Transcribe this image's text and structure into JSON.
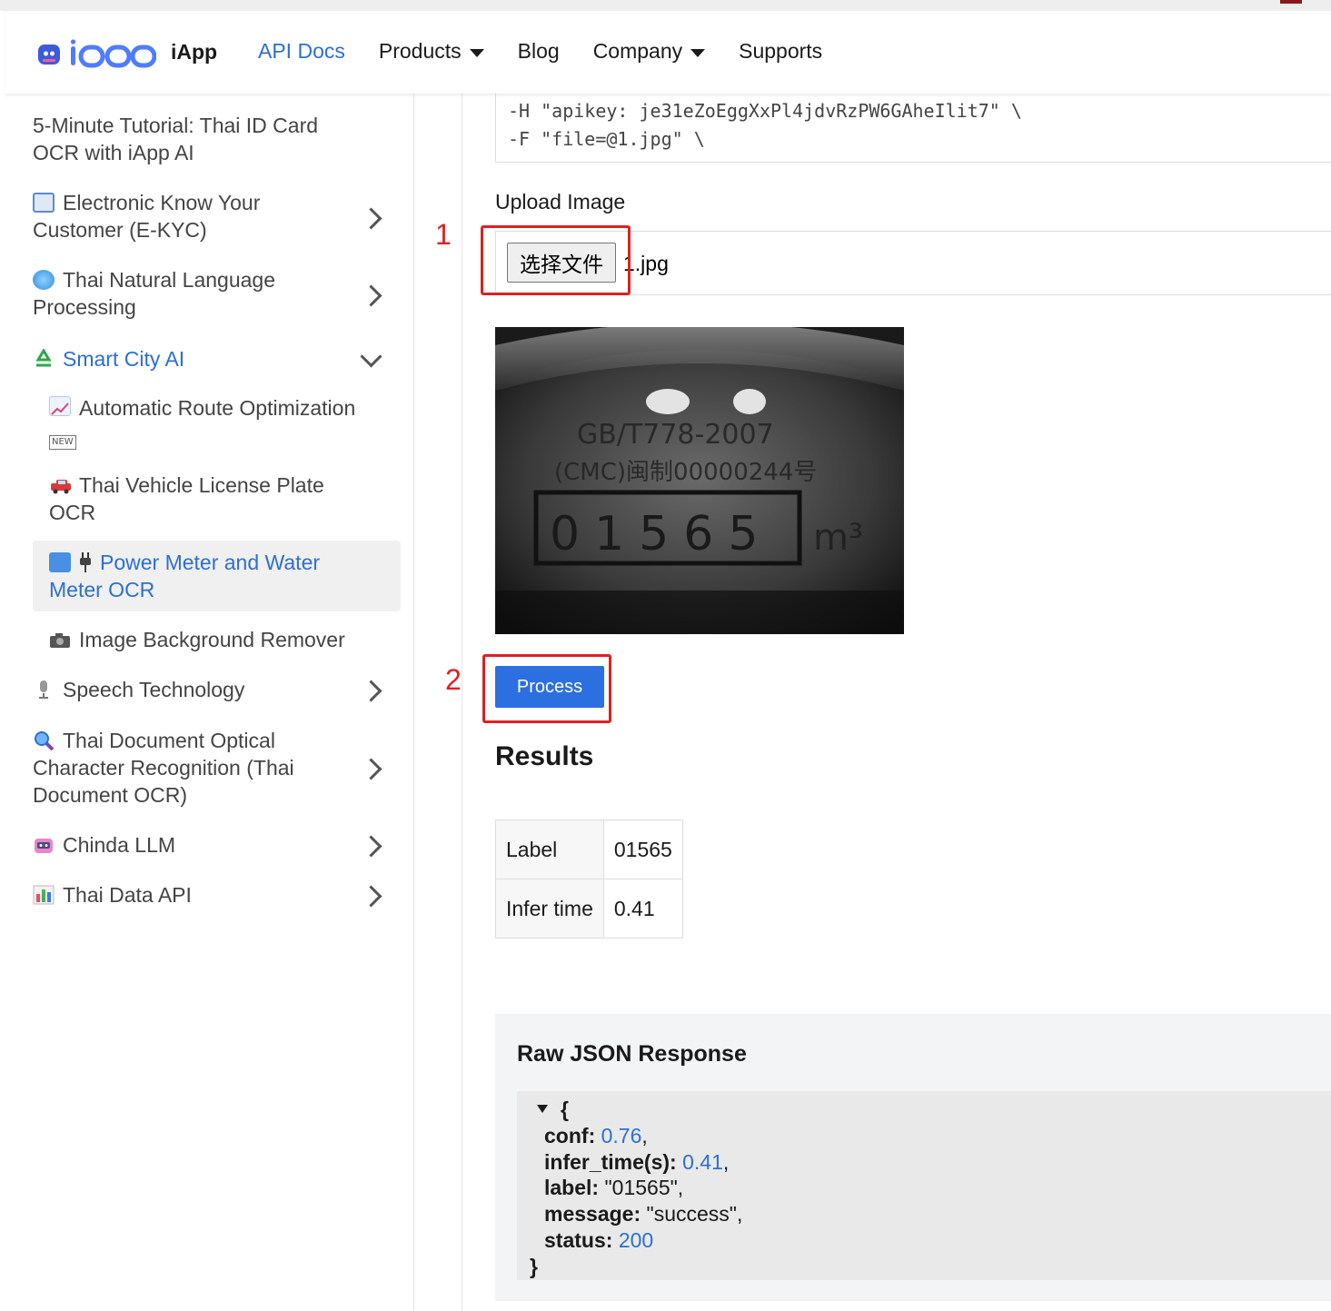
{
  "header": {
    "logo_text": "iapp",
    "brand": "iApp",
    "nav": [
      {
        "label": "API Docs",
        "active": true,
        "dropdown": false
      },
      {
        "label": "Products",
        "active": false,
        "dropdown": true
      },
      {
        "label": "Blog",
        "active": false,
        "dropdown": false
      },
      {
        "label": "Company",
        "active": false,
        "dropdown": true
      },
      {
        "label": "Supports",
        "active": false,
        "dropdown": false
      }
    ]
  },
  "sidebar": {
    "tutorial": "5-Minute Tutorial: Thai ID Card OCR with iApp AI",
    "items": [
      {
        "icon": "id-card-icon",
        "label": "Electronic Know Your Customer (E-KYC)"
      },
      {
        "icon": "globe-icon",
        "label": "Thai Natural Language Processing"
      },
      {
        "icon": "recycle-icon",
        "label": "Smart City AI",
        "expanded": true
      },
      {
        "icon": "microphone-icon",
        "label": "Speech Technology"
      },
      {
        "icon": "magnifier-icon",
        "label": "Thai Document Optical Character Recognition (Thai Document OCR)"
      },
      {
        "icon": "robot-icon",
        "label": "Chinda LLM"
      },
      {
        "icon": "bar-chart-icon",
        "label": "Thai Data API"
      }
    ],
    "subitems": [
      {
        "icon": "line-chart-icon",
        "label": "Automatic Route Optimization",
        "badge": "NEW"
      },
      {
        "icon": "car-icon",
        "label": "Thai Vehicle License Plate OCR"
      },
      {
        "icon": "meter-icon",
        "label": "Power Meter and Water Meter OCR",
        "selected": true
      },
      {
        "icon": "camera-icon",
        "label": "Image Background Remover"
      }
    ]
  },
  "code": {
    "line1": "-H \"apikey: je31eZoEggXxPl4jdvRzPW6GAheIlit7\" \\",
    "line2": "-F \"file=@1.jpg\" \\"
  },
  "upload": {
    "label": "Upload Image",
    "button": "选择文件",
    "filename": "1.jpg"
  },
  "preview": {
    "standard_text": "GB/T778-2007",
    "license_text": "(CMC)闽制00000244号",
    "reading": "01565",
    "unit": "m³"
  },
  "process_button": "Process",
  "annotations": {
    "step1": "1",
    "step2": "2"
  },
  "results": {
    "title": "Results",
    "rows": [
      {
        "key": "Label",
        "value": "01565"
      },
      {
        "key": "Infer time",
        "value": "0.41"
      }
    ]
  },
  "raw": {
    "title": "Raw JSON Response",
    "open": "{",
    "close": "}",
    "fields": [
      {
        "key": "conf",
        "value": "0.76",
        "type": "number"
      },
      {
        "key": "infer_time(s)",
        "value": "0.41",
        "type": "number"
      },
      {
        "key": "label",
        "value": "\"01565\"",
        "type": "string"
      },
      {
        "key": "message",
        "value": "\"success\"",
        "type": "string"
      },
      {
        "key": "status",
        "value": "200",
        "type": "number"
      }
    ]
  }
}
